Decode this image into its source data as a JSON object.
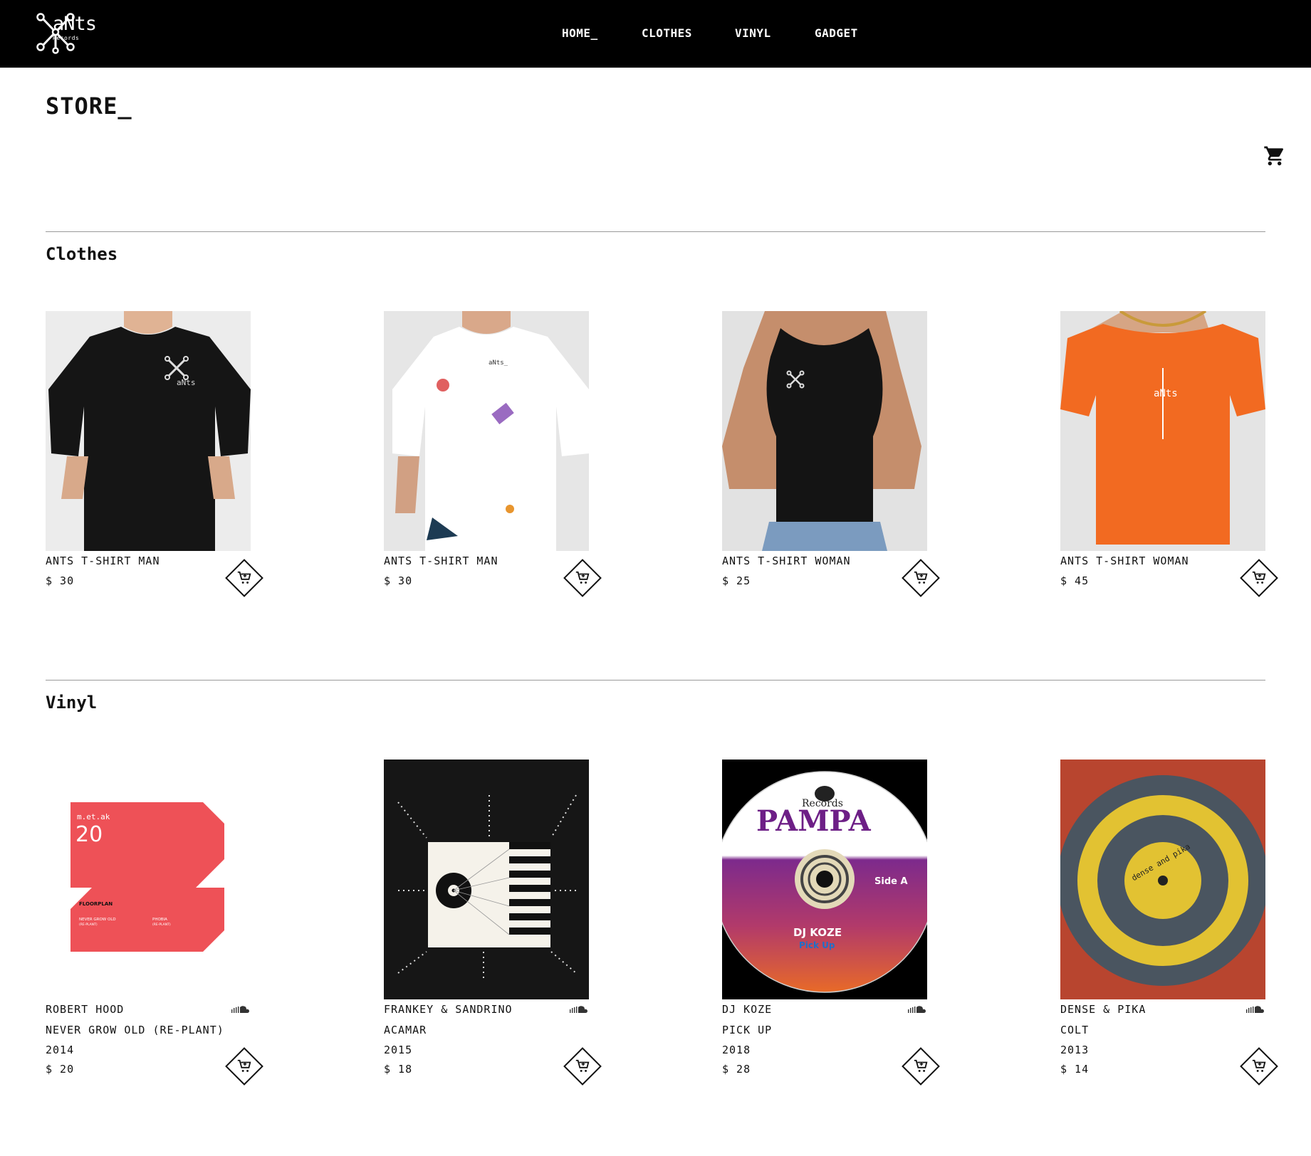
{
  "brand": {
    "name": "aNts",
    "sub": "Records"
  },
  "nav": {
    "items": [
      "HOME_",
      "CLOTHES",
      "VINYL",
      "GADGET"
    ]
  },
  "page": {
    "title": "STORE_"
  },
  "icons": {
    "cart": "shopping-cart-icon",
    "add_to_cart": "add-to-cart-icon",
    "soundcloud": "soundcloud-icon"
  },
  "sections": {
    "clothes": {
      "title": "Clothes",
      "items": [
        {
          "name": "ANTS T-SHIRT MAN",
          "price": "$ 30"
        },
        {
          "name": "ANTS T-SHIRT MAN",
          "price": "$ 30"
        },
        {
          "name": "ANTS T-SHIRT WOMAN",
          "price": "$ 25"
        },
        {
          "name": "ANTS T-SHIRT WOMAN",
          "price": "$ 45"
        }
      ]
    },
    "vinyl": {
      "title": "Vinyl",
      "items": [
        {
          "artist": "ROBERT HOOD",
          "title": "NEVER GROW OLD (RE-PLANT)",
          "year": "2014",
          "price": "$ 20",
          "cover_text": {
            "line1": "FLOORPLAN",
            "line2": "NEVER GROW OLD",
            "line3": "(RE-PLANT)",
            "line4": "PHOBIA",
            "line5": "(RE-PLANT)",
            "num": "20"
          }
        },
        {
          "artist": "FRANKEY & SANDRINO",
          "title": "ACAMAR",
          "year": "2015",
          "price": "$ 18"
        },
        {
          "artist": "DJ KOZE",
          "title": "PICK UP",
          "year": "2018",
          "price": "$ 28",
          "cover_text": {
            "label": "PAMPA",
            "records": "Records",
            "artist": "DJ KOZE",
            "track": "Pick Up",
            "side": "Side A"
          }
        },
        {
          "artist": "DENSE & PIKA",
          "title": "COLT",
          "year": "2013",
          "price": "$ 14",
          "cover_text": {
            "ring": "dense and pika"
          }
        }
      ]
    }
  },
  "colors": {
    "topbar": "#000000",
    "accent_orange": "#f26a21",
    "accent_red": "#ee5157",
    "text": "#111111"
  }
}
